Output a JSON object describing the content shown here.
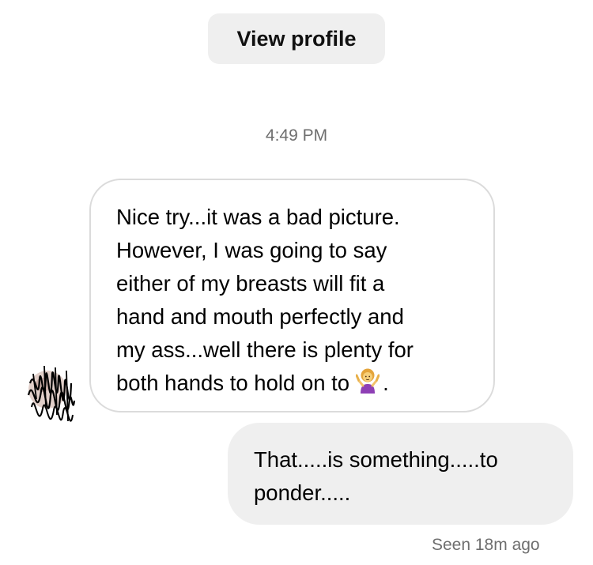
{
  "header": {
    "view_profile_label": "View profile"
  },
  "thread": {
    "timestamp": "4:49 PM",
    "incoming_message": {
      "lines": [
        "Nice try...it was a bad picture.",
        "However, I was going to say",
        "either of my breasts will fit a",
        "hand and mouth perfectly and",
        "my ass...well there is plenty for",
        "both hands to hold on to"
      ],
      "emoji": "person-shrugging-emoji",
      "trailing": "."
    },
    "outgoing_message": {
      "lines": [
        "That.....is something.....to",
        "ponder....."
      ]
    },
    "receipt": "Seen 18m ago"
  },
  "colors": {
    "incoming_border": "#dbdbdb",
    "outgoing_bg": "#efefef",
    "meta_text": "#6e6e6e",
    "button_bg": "#efefef"
  }
}
